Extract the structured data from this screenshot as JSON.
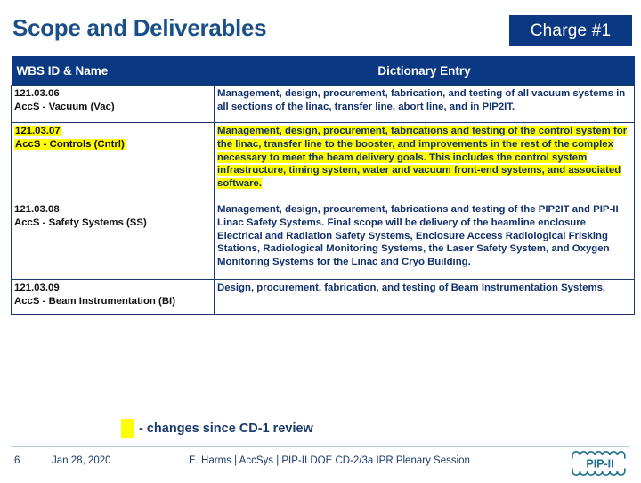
{
  "slide": {
    "title": "Scope and Deliverables",
    "charge_banner": "Charge #1",
    "accent_navy": "#0b3882",
    "title_blue": "#1a4f8a",
    "highlight_yellow": "#ffff00",
    "text_navy": "#12306b"
  },
  "table": {
    "headers": {
      "col1": "WBS ID & Name",
      "col2": "Dictionary Entry"
    },
    "rows": [
      {
        "wbs_id": "121.03.06",
        "wbs_name": "AccS - Vacuum (Vac)",
        "id_highlighted": false,
        "entry": "Management, design, procurement, fabrication, and testing of all vacuum systems in all sections of the linac, transfer line, abort line, and in PIP2IT.",
        "entry_highlighted": false
      },
      {
        "wbs_id": "121.03.07",
        "wbs_name": "AccS - Controls (Cntrl)",
        "id_highlighted": true,
        "entry": "Management, design, procurement, fabrications and testing of the control system for the linac, transfer line to the booster, and improvements in the rest of the complex necessary to meet the beam delivery goals. This includes the control system infrastructure, timing system,  water and vacuum front-end systems, and associated software.",
        "entry_highlighted": true
      },
      {
        "wbs_id": "121.03.08",
        "wbs_name": "AccS - Safety Systems (SS)",
        "id_highlighted": false,
        "entry": "Management, design, procurement, fabrications and testing of the PIP2IT and PIP-II Linac Safety Systems.  Final scope will be delivery of the beamline enclosure Electrical and Radiation Safety Systems, Enclosure Access Radiological Frisking Stations, Radiological Monitoring Systems, the Laser Safety System, and Oxygen Monitoring Systems for the Linac and Cryo Building.",
        "entry_highlighted": false
      },
      {
        "wbs_id": "121.03.09",
        "wbs_name": "AccS - Beam Instrumentation (BI)",
        "id_highlighted": false,
        "entry": "Design, procurement, fabrication, and testing of Beam Instrumentation Systems.",
        "entry_highlighted": false
      }
    ]
  },
  "legend": {
    "label": "- changes since CD-1 review",
    "swatch_color": "#ffff00"
  },
  "footer": {
    "page_number": "6",
    "date": "Jan 28, 2020",
    "center_text": "E. Harms | AccSys | PIP-II DOE CD-2/3a IPR Plenary Session",
    "logo_text": "PIP-II"
  }
}
